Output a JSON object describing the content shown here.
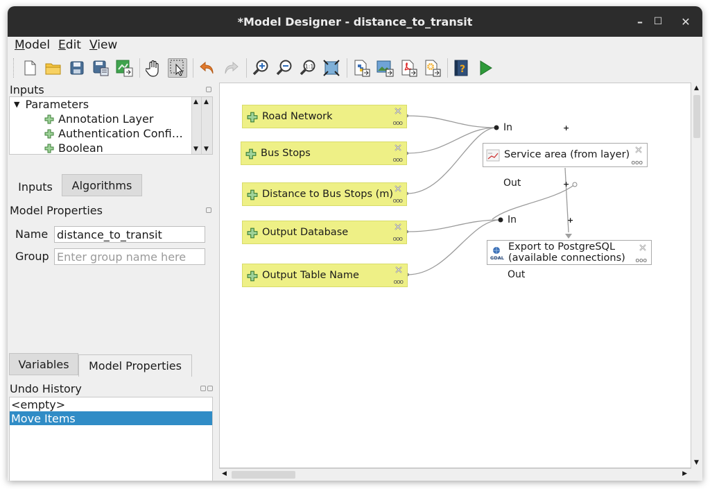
{
  "window": {
    "title": "*Model Designer - distance_to_transit",
    "controls": {
      "minimize": "–",
      "maximize": "☐",
      "close": "✕"
    }
  },
  "menu": [
    "Model",
    "Edit",
    "View"
  ],
  "toolbar": {
    "icons": [
      "new-model-icon",
      "open-model-icon",
      "save-icon",
      "save-as-icon",
      "export-icon",
      "pan-icon",
      "select-icon",
      "undo-icon",
      "redo-icon",
      "zoom-in-icon",
      "zoom-out-icon",
      "zoom-actual-icon",
      "zoom-full-icon",
      "export-python-icon",
      "export-image-icon",
      "export-pdf-icon",
      "export-svg-icon",
      "help-icon",
      "run-icon"
    ]
  },
  "inputs_panel": {
    "title": "Inputs",
    "tree_group": "Parameters",
    "tree_items": [
      "Annotation Layer",
      "Authentication Confi…",
      "Boolean"
    ]
  },
  "left_tabs": [
    "Inputs",
    "Algorithms"
  ],
  "model_properties": {
    "title": "Model Properties",
    "name_label": "Name",
    "name_value": "distance_to_transit",
    "group_label": "Group",
    "group_placeholder": "Enter group name here"
  },
  "bottom_tabs": [
    "Variables",
    "Model Properties"
  ],
  "undo_history": {
    "title": "Undo History",
    "items": [
      "<empty>",
      "Move Items"
    ],
    "selected": "Move Items"
  },
  "canvas": {
    "inputs": [
      "Road Network",
      "Bus Stops",
      "Distance to Bus Stops (m)",
      "Output Database",
      "Output Table Name"
    ],
    "algorithms": [
      {
        "title": "Service area (from layer)",
        "in_label": "In",
        "out_label": "Out"
      },
      {
        "title_line1": "Export to PostgreSQL",
        "title_line2": "(available connections)",
        "in_label": "In",
        "out_label": "Out",
        "badge": "GDAL"
      }
    ]
  },
  "colors": {
    "input_node": "#eef086",
    "selection": "#308cc6",
    "run": "#2e9a3a",
    "undo_arrow": "#e07a2e"
  }
}
